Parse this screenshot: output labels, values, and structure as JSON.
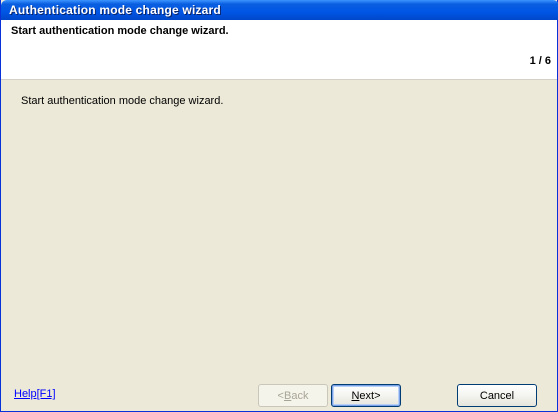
{
  "window": {
    "title": "Authentication mode change wizard"
  },
  "header": {
    "title": "Start authentication mode change wizard.",
    "step": "1 / 6"
  },
  "content": {
    "message": "Start authentication mode change wizard."
  },
  "footer": {
    "help_label": "Help[F1]",
    "back_prefix": "<",
    "back_mnemonic": "B",
    "back_suffix": "ack",
    "back_enabled": false,
    "next_mnemonic": "N",
    "next_suffix": "ext>",
    "cancel_label": "Cancel"
  },
  "colors": {
    "titlebar": "#0055e5",
    "dialog_background": "#ece9d8",
    "link": "#0000ff"
  }
}
